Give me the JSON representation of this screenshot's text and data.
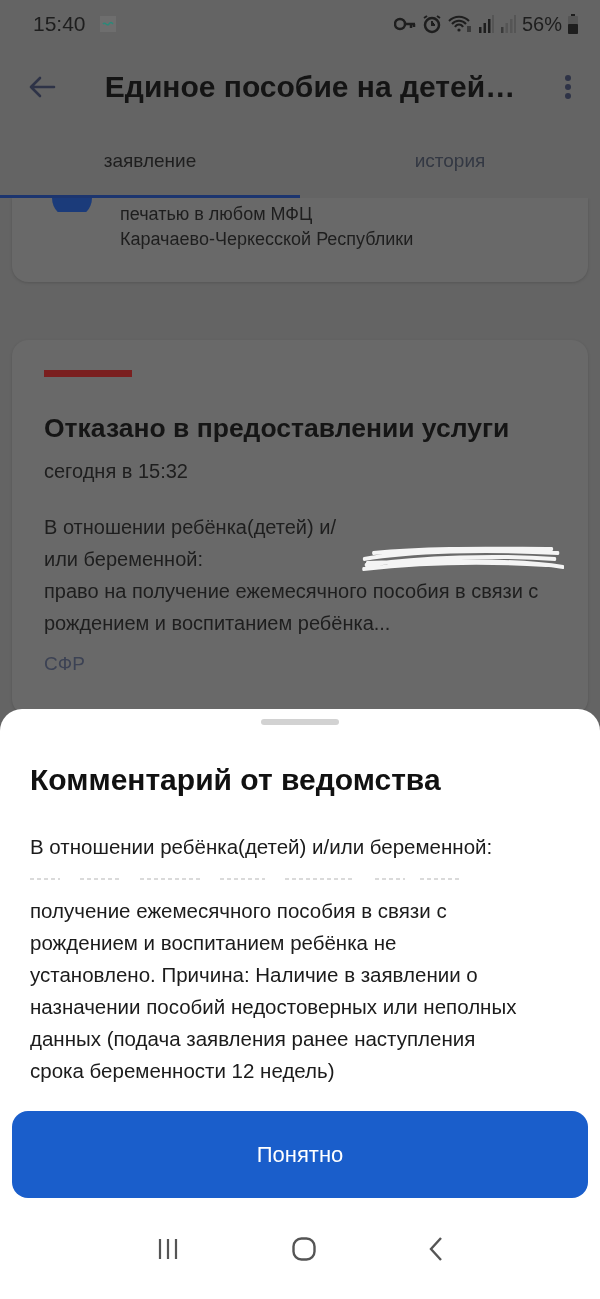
{
  "status_bar": {
    "time": "15:40",
    "battery": "56%"
  },
  "app_bar": {
    "title": "Единое пособие на детей…"
  },
  "tabs": [
    {
      "label": "заявление",
      "selected": true
    },
    {
      "label": "история",
      "selected": false
    }
  ],
  "info_card": {
    "lines": [
      "печатью в любом МФЦ",
      "Карачаево-Черкесской Республики"
    ]
  },
  "status_card": {
    "title": "Отказано в предоставлении услуги",
    "time": "сегодня в 15:32",
    "text_before": "В отношении ребёнка(детей) и/или беременной:",
    "text_after": "право на получение ежемесячного пособия в связи с рождением и воспитанием ребёнка...",
    "source": "СФР"
  },
  "sheet": {
    "title": "Комментарий от ведомства",
    "text_before": "В отношении ребёнка(детей) и/или беременной:",
    "text_after": "получение ежемесячного пособия в связи с рождением и воспитанием ребёнка не установлено. Причина: Наличие в заявлении о назначении пособий недостоверных или неполных данных (подача заявления ранее наступления срока беременности 12 недель)",
    "button": "Понятно"
  }
}
